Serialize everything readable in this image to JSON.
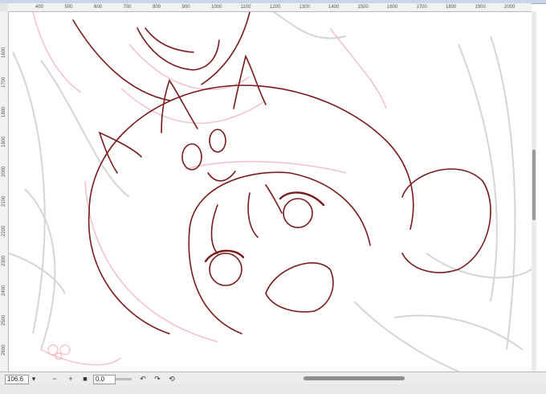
{
  "ruler": {
    "top_ticks": [
      "400",
      "500",
      "600",
      "700",
      "800",
      "900",
      "1000",
      "1100",
      "1200",
      "1300",
      "1400",
      "1500",
      "1600",
      "1700",
      "1800",
      "1900",
      "2000"
    ],
    "left_ticks": [
      "1600",
      "1700",
      "1800",
      "1900",
      "2000",
      "2100",
      "2200",
      "2300",
      "2400",
      "2500",
      "2600"
    ]
  },
  "bottombar": {
    "zoom_value": "106.6",
    "angle_value": "0.0"
  },
  "icons": {
    "zoom_out": "minus-icon",
    "zoom_in": "plus-icon",
    "fit": "square-icon",
    "rotate_left": "rotate-left-icon",
    "rotate_right": "rotate-right-icon",
    "reset_rotation": "reset-icon"
  },
  "colors": {
    "line_dark": "#7a1a1a",
    "line_pink": "#f2b8c0",
    "line_grey": "#c8ccc8"
  }
}
